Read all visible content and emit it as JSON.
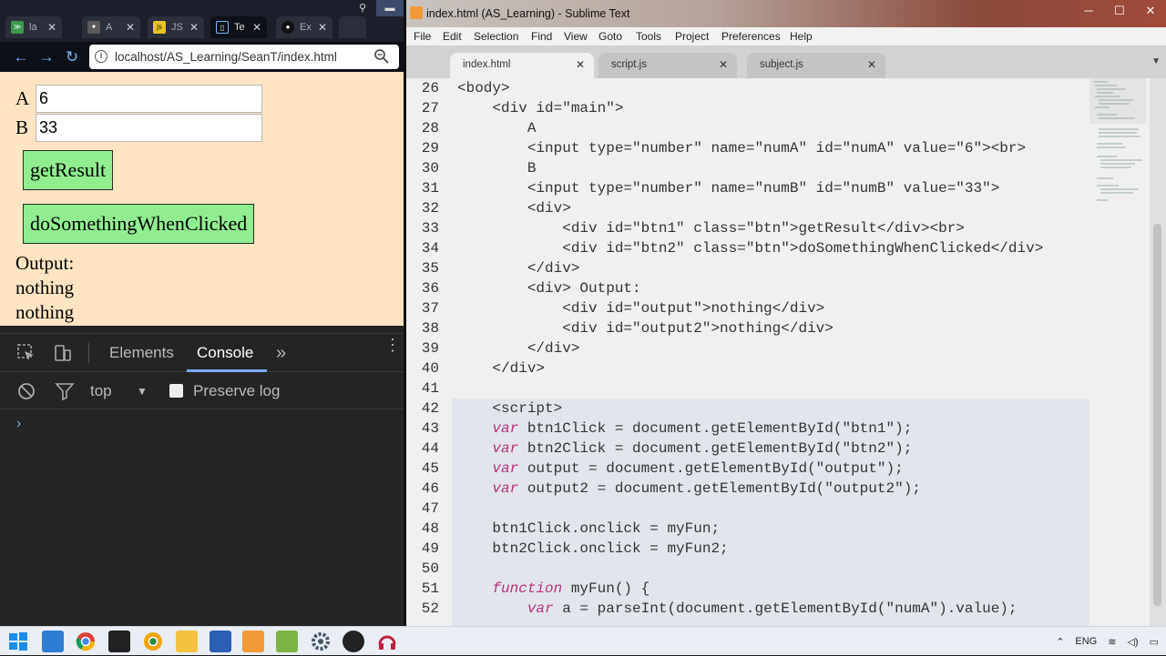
{
  "chrome": {
    "tabs": [
      {
        "label": "la",
        "fav": "vs-code-icon",
        "color": "#3c9a4b"
      },
      {
        "label": "A",
        "fav": "settings-icon",
        "color": "#5a5a5a"
      },
      {
        "label": "JS",
        "fav": "js-icon",
        "color": "#e8c22b"
      },
      {
        "label": "Te",
        "fav": "doc-icon",
        "color": "#2b2f3a"
      },
      {
        "label": "Ex",
        "fav": "github-icon",
        "color": "#111111"
      }
    ],
    "url": "localhost/AS_Learning/SeanT/index.html"
  },
  "page": {
    "label_a": "A",
    "value_a": "6",
    "label_b": "B",
    "value_b": "33",
    "btn1": "getResult",
    "btn2": "doSomethingWhenClicked",
    "output_label": "Output:",
    "output1": "nothing",
    "output2": "nothing"
  },
  "devtools": {
    "tab_elements": "Elements",
    "tab_console": "Console",
    "more": "»",
    "context": "top",
    "preserve_log": "Preserve log",
    "prompt": "›"
  },
  "sublime": {
    "title": "index.html (AS_Learning) - Sublime Text",
    "menu": [
      "File",
      "Edit",
      "Selection",
      "Find",
      "View",
      "Goto",
      "Tools",
      "Project",
      "Preferences",
      "Help"
    ],
    "tabs": [
      "index.html",
      "script.js",
      "subject.js"
    ],
    "lines": [
      {
        "n": "26",
        "t": "<body>"
      },
      {
        "n": "27",
        "t": "    <div id=\"main\">"
      },
      {
        "n": "28",
        "t": "        A"
      },
      {
        "n": "29",
        "t": "        <input type=\"number\" name=\"numA\" id=\"numA\" value=\"6\"><br>"
      },
      {
        "n": "30",
        "t": "        B"
      },
      {
        "n": "31",
        "t": "        <input type=\"number\" name=\"numB\" id=\"numB\" value=\"33\">"
      },
      {
        "n": "32",
        "t": "        <div>"
      },
      {
        "n": "33",
        "t": "            <div id=\"btn1\" class=\"btn\">getResult</div><br>"
      },
      {
        "n": "34",
        "t": "            <div id=\"btn2\" class=\"btn\">doSomethingWhenClicked</div>"
      },
      {
        "n": "35",
        "t": "        </div>"
      },
      {
        "n": "36",
        "t": "        <div> Output:"
      },
      {
        "n": "37",
        "t": "            <div id=\"output\">nothing</div>"
      },
      {
        "n": "38",
        "t": "            <div id=\"output2\">nothing</div>"
      },
      {
        "n": "39",
        "t": "        </div>"
      },
      {
        "n": "40",
        "t": "    </div>"
      },
      {
        "n": "41",
        "t": ""
      },
      {
        "n": "42",
        "t": "    <script>"
      },
      {
        "n": "43",
        "t": "    var btn1Click = document.getElementById(\"btn1\");"
      },
      {
        "n": "44",
        "t": "    var btn2Click = document.getElementById(\"btn2\");"
      },
      {
        "n": "45",
        "t": "    var output = document.getElementById(\"output\");"
      },
      {
        "n": "46",
        "t": "    var output2 = document.getElementById(\"output2\");"
      },
      {
        "n": "47",
        "t": ""
      },
      {
        "n": "48",
        "t": "    btn1Click.onclick = myFun;"
      },
      {
        "n": "49",
        "t": "    btn2Click.onclick = myFun2;"
      },
      {
        "n": "50",
        "t": ""
      },
      {
        "n": "51",
        "t": "    function myFun() {"
      },
      {
        "n": "52",
        "t": "        var a = parseInt(document.getElementById(\"numA\").value);"
      }
    ]
  },
  "taskbar": {
    "lang": "ENG"
  }
}
